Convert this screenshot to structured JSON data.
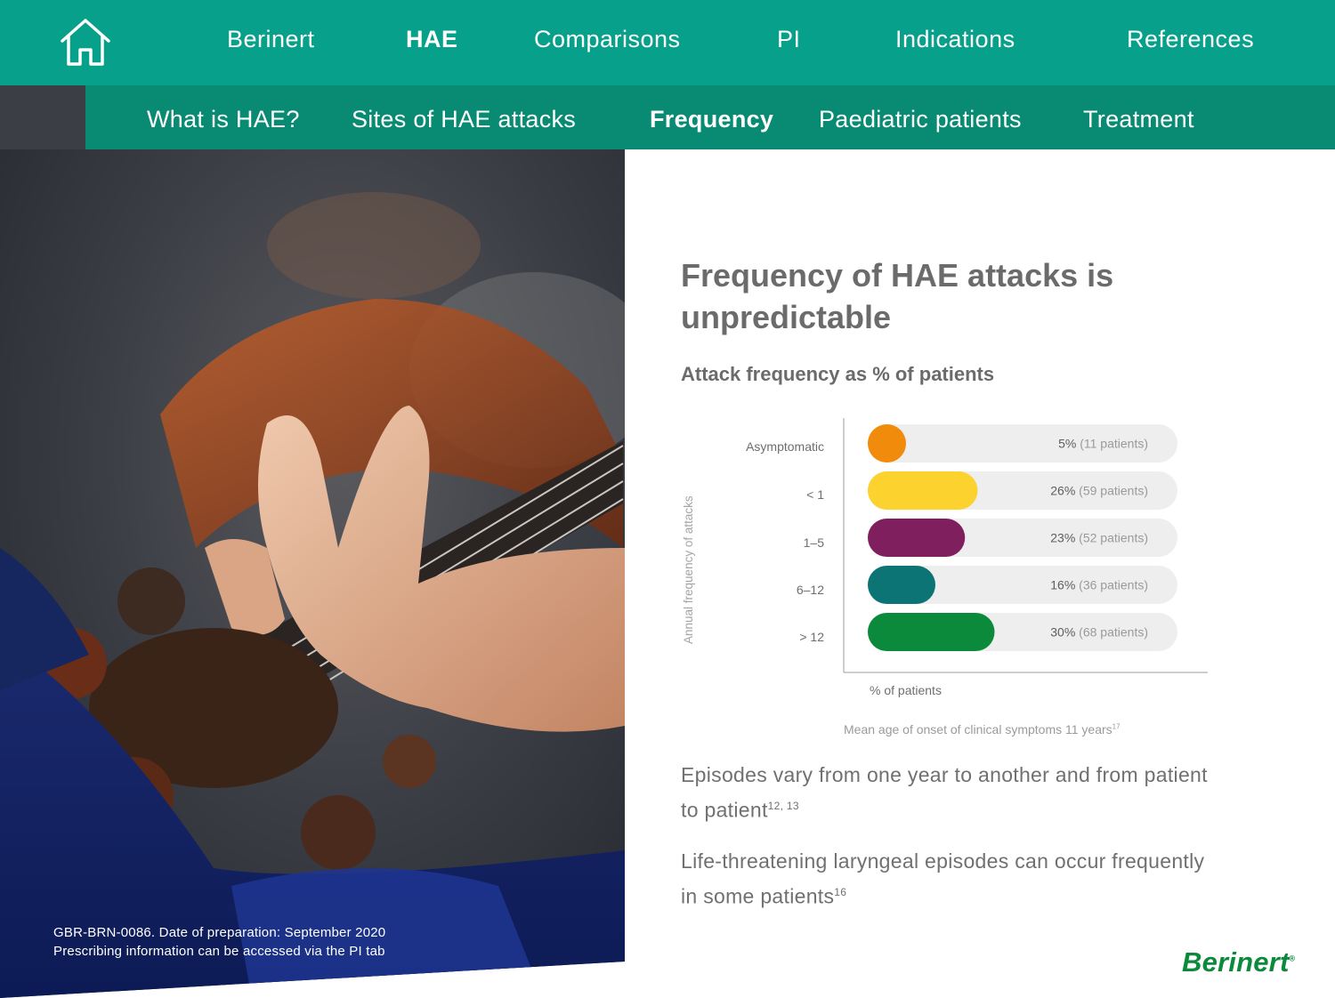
{
  "nav": {
    "home_icon": "home-icon",
    "items": [
      {
        "label": "Berinert",
        "active": false
      },
      {
        "label": "HAE",
        "active": true
      },
      {
        "label": "Comparisons",
        "active": false
      },
      {
        "label": "PI",
        "active": false
      },
      {
        "label": "Indications",
        "active": false
      },
      {
        "label": "References",
        "active": false
      }
    ]
  },
  "subnav": {
    "items": [
      {
        "label": "What is HAE?",
        "active": false
      },
      {
        "label": "Sites of HAE attacks",
        "active": false
      },
      {
        "label": "Frequency",
        "active": true
      },
      {
        "label": "Paediatric patients",
        "active": false
      },
      {
        "label": "Treatment",
        "active": false
      }
    ]
  },
  "photo": {
    "legal_line1": "GBR-BRN-0086. Date of preparation: September 2020",
    "legal_line2": "Prescribing information can be accessed via the PI tab"
  },
  "content": {
    "headline": "Frequency of HAE attacks is unpredictable",
    "subheading": "Attack frequency as % of patients",
    "note": "Mean age of onset of clinical symptoms 11 years",
    "note_ref": "17",
    "para1": "Episodes vary from one year to another and from patient to patient",
    "para1_ref": "12, 13",
    "para2": "Life-threatening laryngeal episodes can occur frequently in some patients",
    "para2_ref": "16"
  },
  "chart_data": {
    "type": "bar",
    "orientation": "horizontal",
    "ylabel": "Annual frequency of attacks",
    "xlabel": "% of patients",
    "categories": [
      "Asymptomatic",
      "< 1",
      "1–5",
      "6–12",
      "> 12"
    ],
    "values": [
      5,
      26,
      23,
      16,
      30
    ],
    "patients": [
      11,
      59,
      52,
      36,
      68
    ],
    "labels_pct": [
      "5%",
      "26%",
      "23%",
      "16%",
      "30%"
    ],
    "labels_patients": [
      "(11 patients)",
      "(59 patients)",
      "(52 patients)",
      "(36 patients)",
      "(68 patients)"
    ],
    "colors": [
      "#f18b0c",
      "#fcd22e",
      "#7f1f5e",
      "#0d7476",
      "#0b8a3c"
    ],
    "track_color": "#eeeeee"
  },
  "brand": {
    "logo_text": "Berinert",
    "logo_mark": "®",
    "nav_color": "#07a08a",
    "subnav_color": "#098b73"
  }
}
